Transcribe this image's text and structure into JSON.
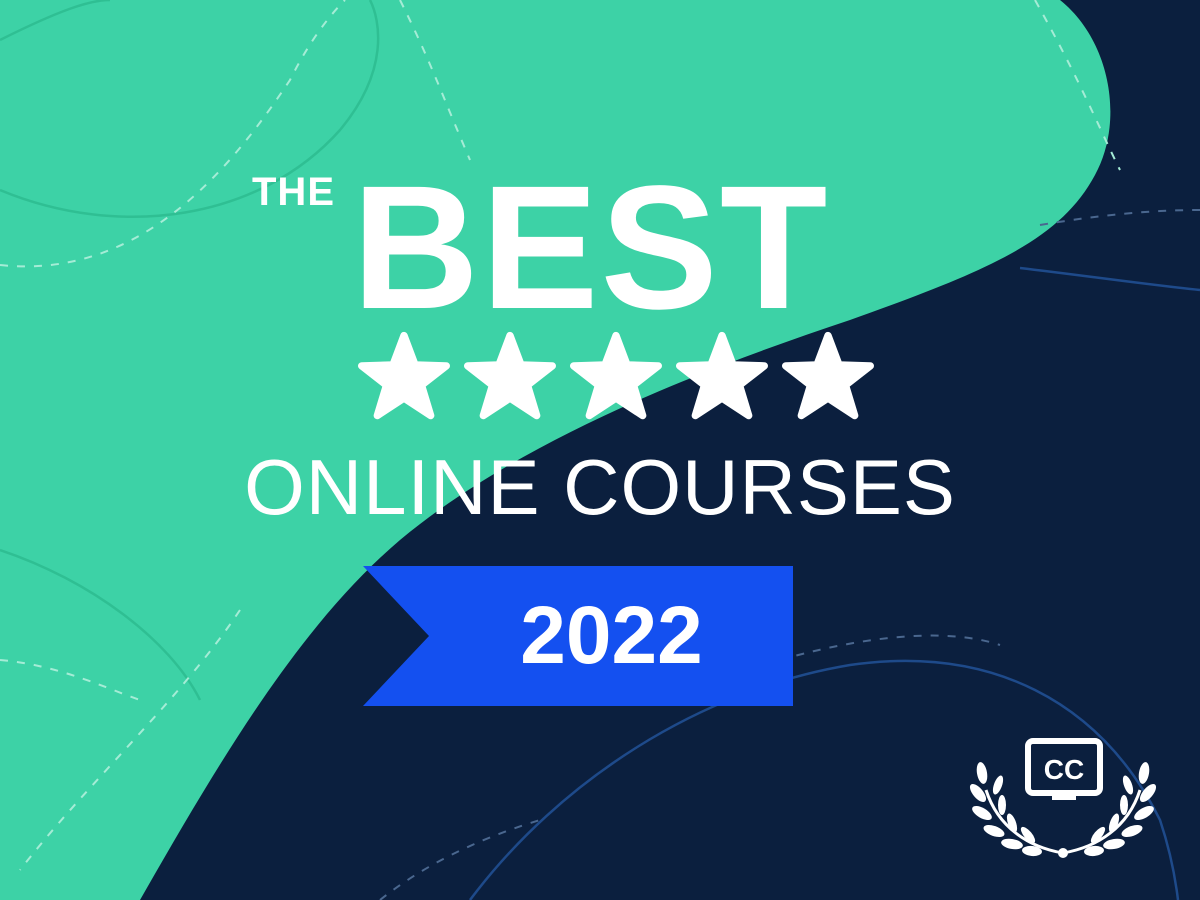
{
  "headline": {
    "the": "THE",
    "best": "BEST",
    "subtitle": "ONLINE COURSES"
  },
  "rating": {
    "stars": 5,
    "max": 5
  },
  "badge": {
    "year": "2022"
  },
  "logo": {
    "text": "CC",
    "icon": "laurel-wreath-icon"
  },
  "colors": {
    "navy": "#0b1f3e",
    "green": "#3dd2a6",
    "ribbon_blue": "#1450f0",
    "white": "#ffffff"
  }
}
